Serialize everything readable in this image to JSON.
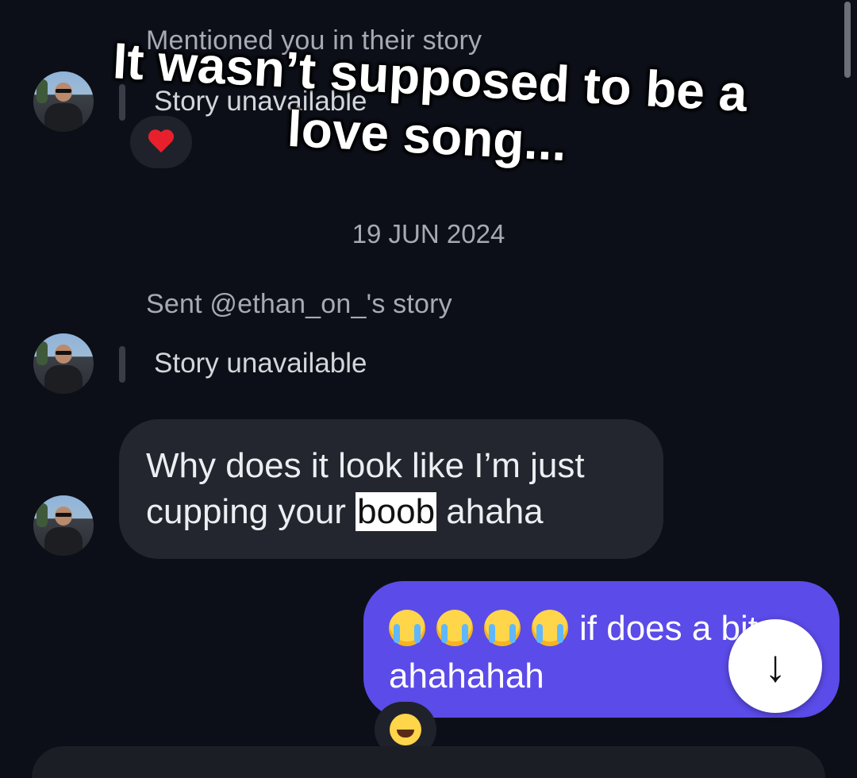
{
  "thread": {
    "mention_label": "Mentioned you in their story",
    "mention_story_text": "Story unavailable",
    "date_label": "19 JUN 2024",
    "sent_story_label": "Sent @ethan_on_'s story",
    "sent_story_text": "Story unavailable",
    "incoming_message": {
      "text_before": "Why does it look like I’m just cupping your ",
      "highlighted": "boob",
      "text_after": " ahaha"
    },
    "outgoing_message": {
      "emoji_count": 4,
      "text": "if does a bit ahahahah"
    },
    "reaction_heart": "heart-icon",
    "reaction_laugh": "laughing-emoji"
  },
  "overlay": {
    "line1": "It wasn’t supposed to be a",
    "line2": "love song..."
  },
  "scroll_button": {
    "icon": "arrow-down-icon",
    "glyph": "↓"
  }
}
